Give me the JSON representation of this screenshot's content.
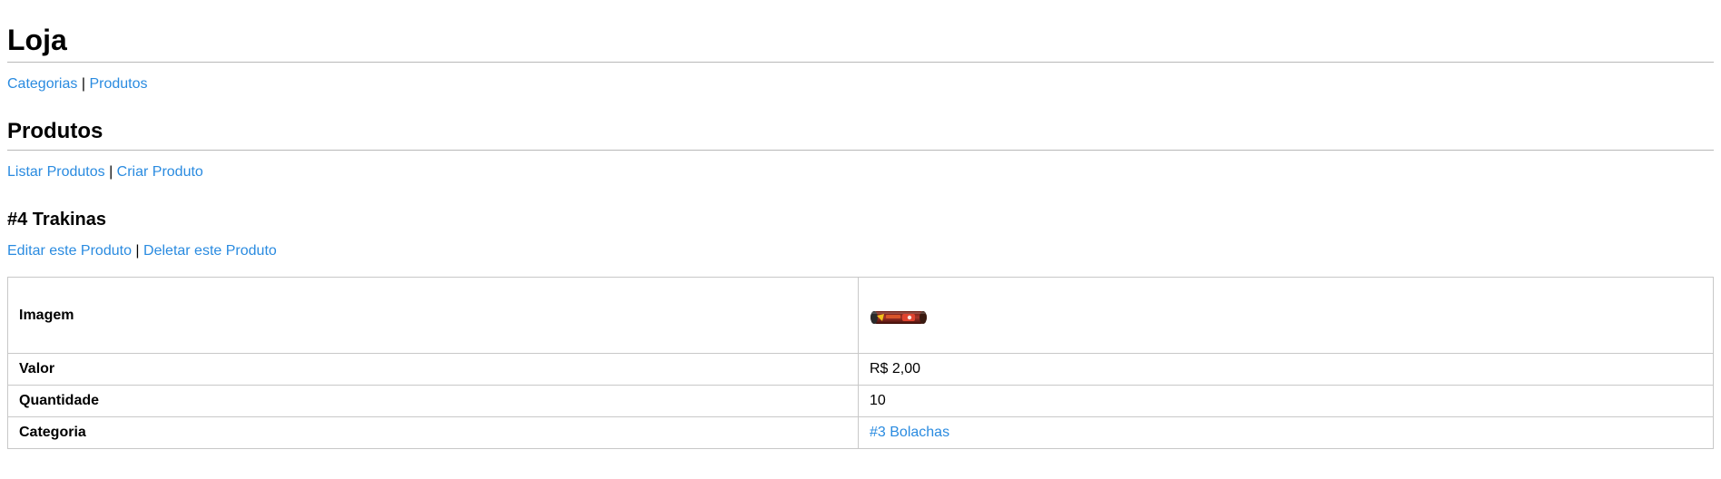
{
  "site": {
    "title": "Loja"
  },
  "main_nav": {
    "items": [
      "Categorias",
      "Produtos"
    ],
    "separator": "|"
  },
  "section": {
    "title": "Produtos"
  },
  "sub_nav": {
    "items": [
      "Listar Produtos",
      "Criar Produto"
    ],
    "separator": "|"
  },
  "product": {
    "title": "#4 Trakinas",
    "actions": [
      "Editar este Produto",
      "Deletar este Produto"
    ],
    "separator": "|",
    "rows": [
      {
        "label": "Imagem",
        "value": ""
      },
      {
        "label": "Valor",
        "value": "R$ 2,00"
      },
      {
        "label": "Quantidade",
        "value": "10"
      },
      {
        "label": "Categoria",
        "value": "#3 Bolachas"
      }
    ]
  },
  "colors": {
    "link": "#2a8be0",
    "rule": "#b8b8b8",
    "border": "#c8c8c8"
  }
}
